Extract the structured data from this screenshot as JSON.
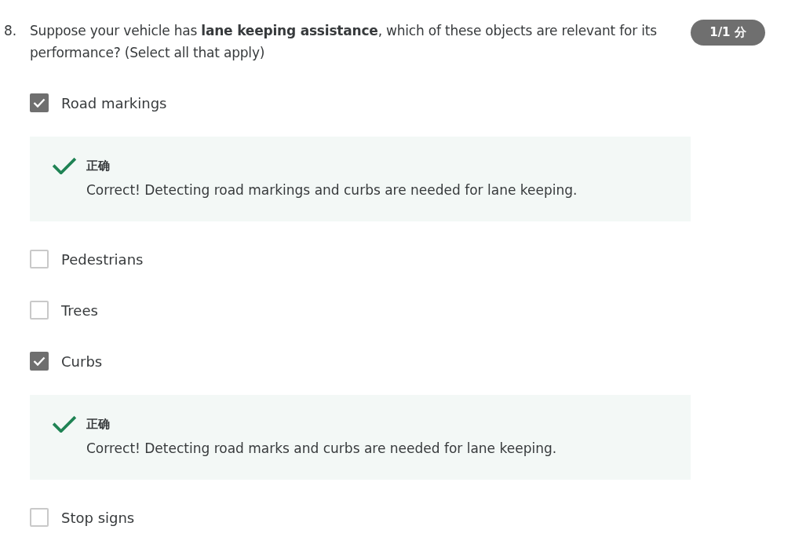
{
  "question": {
    "number": "8.",
    "text": "Suppose your vehicle has **lane keeping assistance**, which of these objects are relevant for its performance? (Select all that apply)",
    "score": "1/1 分"
  },
  "options": [
    {
      "label": "Road markings",
      "checked": true,
      "feedback": {
        "kind": "correct",
        "title": "正确",
        "text": "Correct! Detecting road markings and curbs are needed for lane keeping."
      }
    },
    {
      "label": "Pedestrians",
      "checked": false
    },
    {
      "label": "Trees",
      "checked": false
    },
    {
      "label": "Curbs",
      "checked": true,
      "feedback": {
        "kind": "correct",
        "title": "正确",
        "text": "Correct! Detecting road marks and curbs are needed for lane keeping."
      }
    },
    {
      "label": "Stop signs",
      "checked": false
    }
  ]
}
